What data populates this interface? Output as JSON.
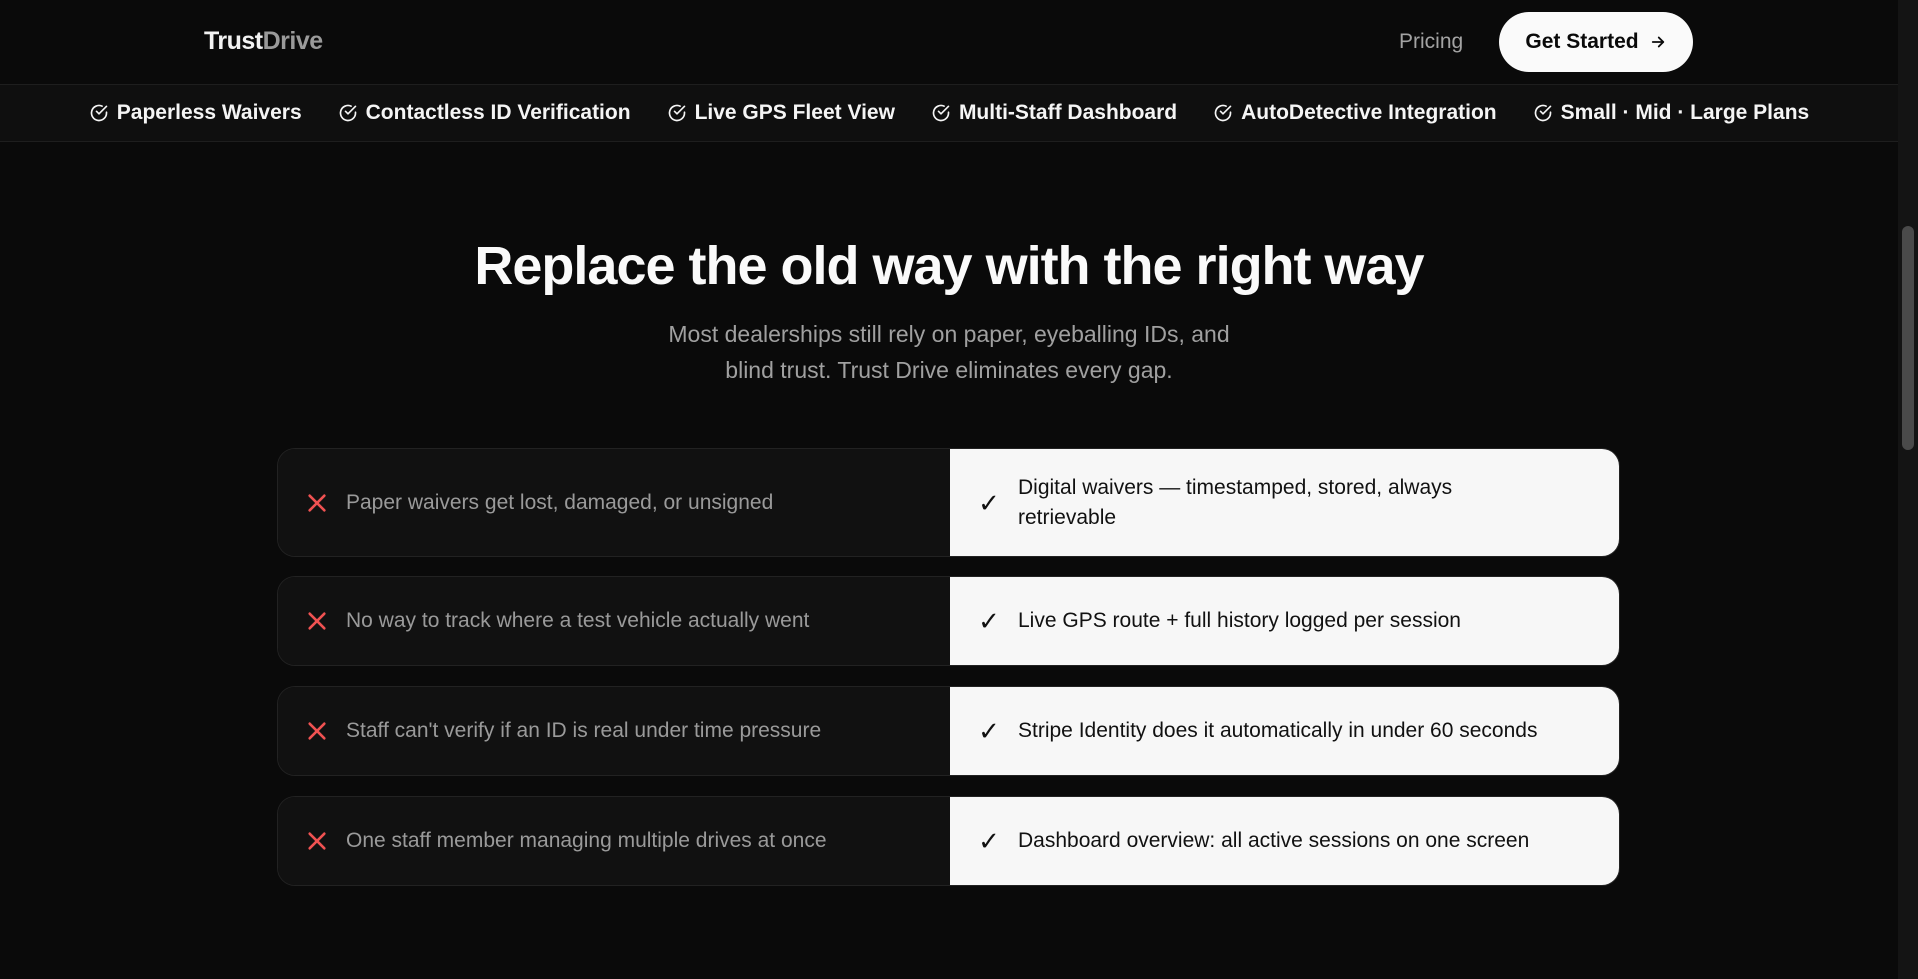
{
  "header": {
    "logo": {
      "part1": "Trust",
      "part2": "Drive"
    },
    "nav": {
      "pricing": "Pricing"
    },
    "cta": {
      "label": "Get Started",
      "icon": "arrow-right-icon"
    }
  },
  "features": [
    {
      "label": "Paperless Waivers",
      "icon": "check-circle-icon"
    },
    {
      "label": "Contactless ID Verification",
      "icon": "check-circle-icon"
    },
    {
      "label": "Live GPS Fleet View",
      "icon": "check-circle-icon"
    },
    {
      "label": "Multi-Staff Dashboard",
      "icon": "check-circle-icon"
    },
    {
      "label": "AutoDetective Integration",
      "icon": "check-circle-icon"
    },
    {
      "label": "Small · Mid · Large Plans",
      "icon": "check-circle-icon"
    }
  ],
  "hero": {
    "title": "Replace the old way with the right way",
    "subtitle_line1": "Most dealerships still rely on paper, eyeballing IDs, and",
    "subtitle_line2": "blind trust. Trust Drive eliminates every gap."
  },
  "comparison": [
    {
      "old": "Paper waivers get lost, damaged, or unsigned",
      "new": "Digital waivers — timestamped, stored, always retrievable"
    },
    {
      "old": "No way to track where a test vehicle actually went",
      "new": "Live GPS route + full history logged per session"
    },
    {
      "old": "Staff can't verify if an ID is real under time pressure",
      "new": "Stripe Identity does it automatically in under 60 seconds"
    },
    {
      "old": "One staff member managing multiple drives at once",
      "new": "Dashboard overview: all active sessions on one screen"
    }
  ],
  "symbols": {
    "check": "✓"
  },
  "colors": {
    "x_icon": "#f05252",
    "background": "#0a0a0a",
    "new_panel": "#f7f7f7"
  }
}
